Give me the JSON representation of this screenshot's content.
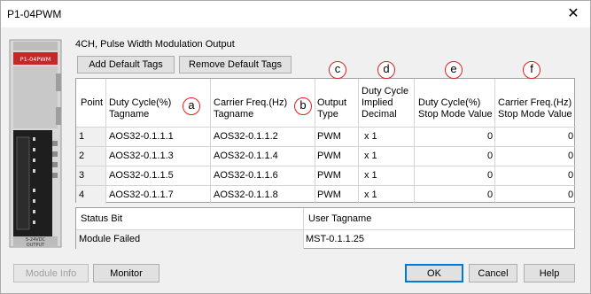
{
  "window": {
    "title": "P1-04PWM",
    "close_glyph": "✕"
  },
  "module": {
    "brand_label": "P1-04PWM",
    "voltage_label": "5-24VDC",
    "output_label": "OUTPUT"
  },
  "subtitle": "4CH, Pulse Width Modulation Output",
  "toolbar": {
    "add_default_tags": "Add Default Tags",
    "remove_default_tags": "Remove Default Tags"
  },
  "grid": {
    "headers": {
      "point": "Point",
      "duty_tag_1": "Duty Cycle(%)",
      "duty_tag_2": "Tagname",
      "carrier_tag_1": "Carrier Freq.(Hz)",
      "carrier_tag_2": "Tagname",
      "output_type_1": "Output",
      "output_type_2": "Type",
      "implied_1": "Duty Cycle",
      "implied_2": "Implied",
      "implied_3": "Decimal",
      "duty_stop_1": "Duty Cycle(%)",
      "duty_stop_2": "Stop Mode Value",
      "carrier_stop_1": "Carrier Freq.(Hz)",
      "carrier_stop_2": "Stop Mode Value"
    },
    "markers": {
      "a": "a",
      "b": "b",
      "c": "c",
      "d": "d",
      "e": "e",
      "f": "f"
    },
    "rows": [
      {
        "point": "1",
        "duty_tag": "AOS32-0.1.1.1",
        "carrier_tag": "AOS32-0.1.1.2",
        "type": "PWM",
        "decimal": "x 1",
        "duty_stop": "0",
        "carrier_stop": "0"
      },
      {
        "point": "2",
        "duty_tag": "AOS32-0.1.1.3",
        "carrier_tag": "AOS32-0.1.1.4",
        "type": "PWM",
        "decimal": "x 1",
        "duty_stop": "0",
        "carrier_stop": "0"
      },
      {
        "point": "3",
        "duty_tag": "AOS32-0.1.1.5",
        "carrier_tag": "AOS32-0.1.1.6",
        "type": "PWM",
        "decimal": "x 1",
        "duty_stop": "0",
        "carrier_stop": "0"
      },
      {
        "point": "4",
        "duty_tag": "AOS32-0.1.1.7",
        "carrier_tag": "AOS32-0.1.1.8",
        "type": "PWM",
        "decimal": "x 1",
        "duty_stop": "0",
        "carrier_stop": "0"
      }
    ]
  },
  "status_grid": {
    "header_status_bit": "Status Bit",
    "header_user_tagname": "User Tagname",
    "row_label": "Module Failed",
    "row_value": "MST-0.1.1.25"
  },
  "footer": {
    "module_info": "Module Info",
    "monitor": "Monitor",
    "ok": "OK",
    "cancel": "Cancel",
    "help": "Help"
  }
}
